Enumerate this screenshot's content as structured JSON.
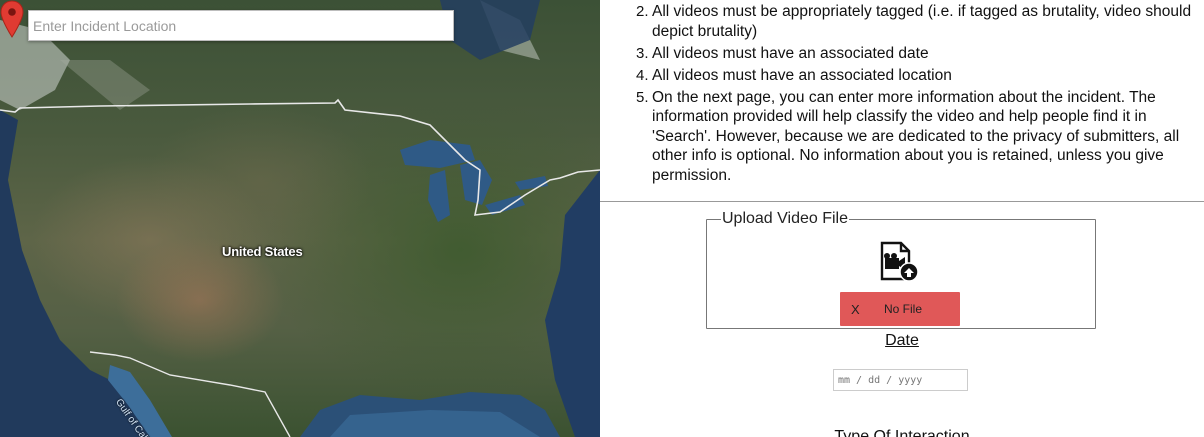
{
  "map": {
    "search_placeholder": "Enter Incident Location",
    "country_label": "United States",
    "gulf_label": "Gulf of Cali",
    "pin_color": "#e03b32"
  },
  "rules": [
    {
      "number": "2.",
      "text": "All videos must be appropriately tagged (i.e. if tagged as brutality, video should depict brutality)"
    },
    {
      "number": "3.",
      "text": "All videos must have an associated date"
    },
    {
      "number": "4.",
      "text": "All videos must have an associated location"
    },
    {
      "number": "5.",
      "text": "On the next page, you can enter more information about the incident. The information provided will help classify the video and help people find it in 'Search'. However, because we are dedicated to the privacy of submitters, all other info is optional. No information about you is retained, unless you give permission."
    }
  ],
  "upload": {
    "legend": "Upload Video File",
    "icon": "video-upload-icon",
    "clear_label": "X",
    "file_name": "No File",
    "button_color": "#e05858"
  },
  "date": {
    "label": "Date",
    "placeholder": "mm / dd / yyyy"
  },
  "interaction": {
    "label": "Type Of Interaction"
  }
}
